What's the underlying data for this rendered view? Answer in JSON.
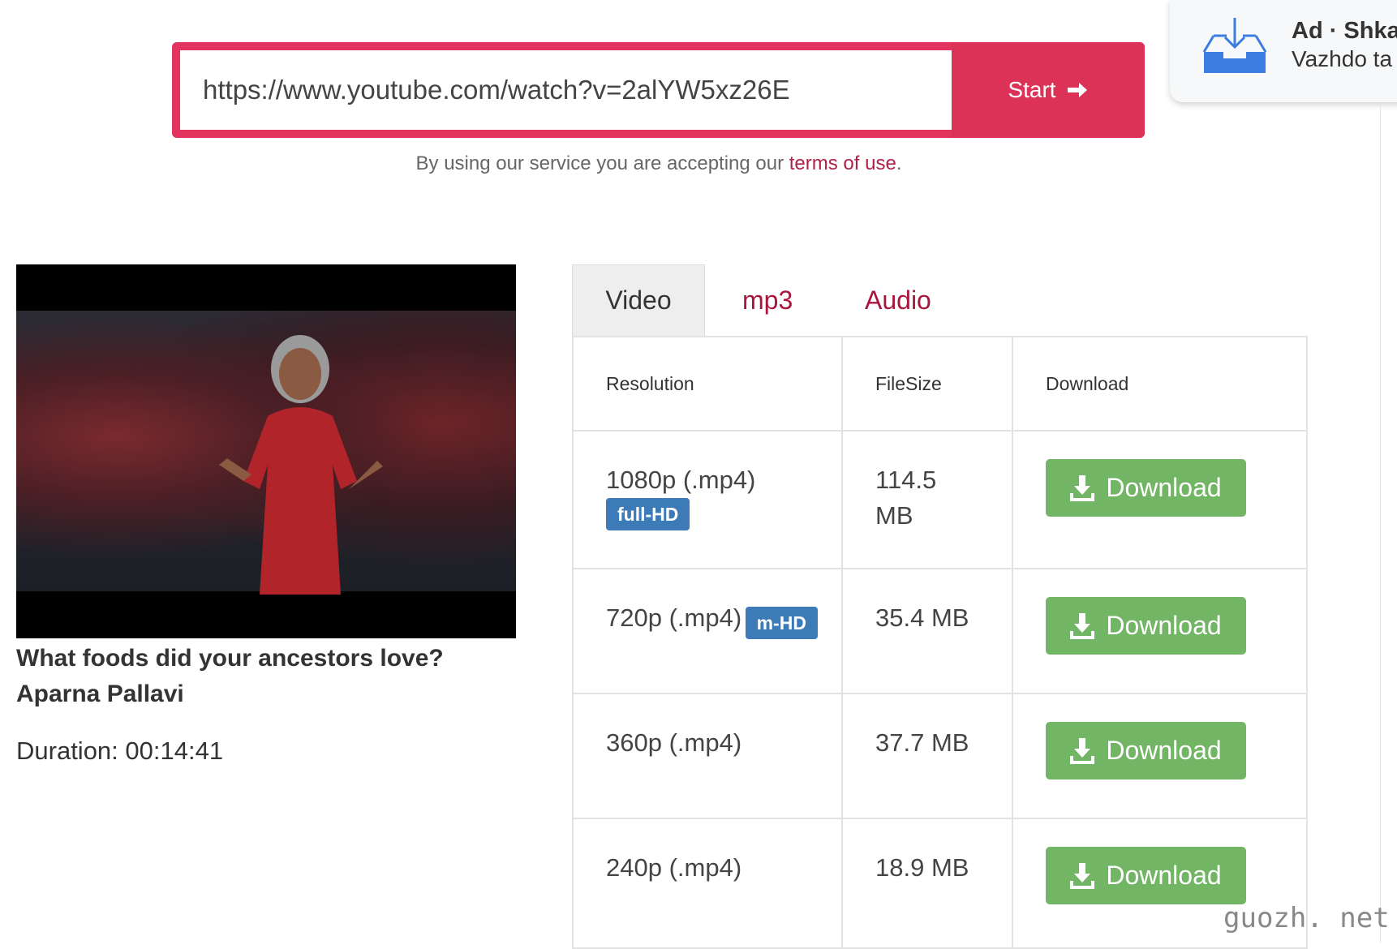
{
  "search": {
    "url_value": "https://www.youtube.com/watch?v=2alYW5xz26E",
    "start_label": "Start"
  },
  "terms": {
    "prefix": "By using our service you are accepting our ",
    "link": "terms of use",
    "suffix": "."
  },
  "ad": {
    "title": "Ad · Shka",
    "subtitle": "Vazhdo ta"
  },
  "video": {
    "title": "What foods did your ancestors love? Aparna Pallavi",
    "duration": "Duration: 00:14:41"
  },
  "tabs": [
    {
      "label": "Video",
      "active": true
    },
    {
      "label": "mp3"
    },
    {
      "label": "Audio"
    }
  ],
  "table": {
    "headers": [
      "Resolution",
      "FileSize",
      "Download"
    ],
    "rows": [
      {
        "resolution": "1080p (.mp4)",
        "badge": "full-HD",
        "size": "114.5 MB",
        "button": "Download"
      },
      {
        "resolution": "720p (.mp4)",
        "badge": "m-HD",
        "size": "35.4 MB",
        "button": "Download"
      },
      {
        "resolution": "360p (.mp4)",
        "size": "37.7 MB",
        "button": "Download"
      },
      {
        "resolution": "240p (.mp4)",
        "size": "18.9 MB",
        "button": "Download"
      }
    ]
  },
  "watermark": "guozh. net",
  "colors": {
    "accent": "#dc3257",
    "tab_link": "#a8163e",
    "download": "#72b564",
    "badge": "#3d7ab8"
  }
}
